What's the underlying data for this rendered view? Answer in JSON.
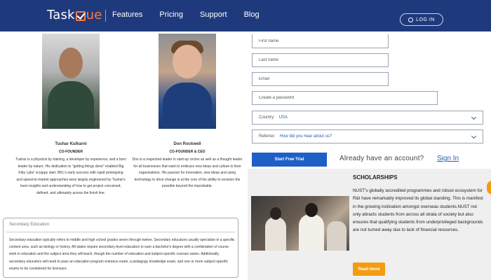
{
  "header": {
    "logo_text": "Task",
    "logo_accent": "ue",
    "nav": [
      "Features",
      "Pricing",
      "Support",
      "Blog"
    ],
    "login_label": "LOG IN"
  },
  "founders": [
    {
      "name": "Tushar Kulkarni",
      "role": "CO-FOUNDER",
      "bio": "Tushar is a physicist by training, a developer by experience, and a born leader by nature. His dedication to \"getting things done\" enabled Big Kitty Labs' scrappy start. BKL's early success with rapid prototyping and speed-to-market approaches were largely engineered by Tushar's keen insights and understanding of how to get project conceived, defined, and ultimately across the finish line."
    },
    {
      "name": "Don Rockwell",
      "role": "CO-FOUNDER & CEO",
      "bio": "Don is a respected leader in start-up circles as well as a thought leader for all businesses that want to embrace new ideas and culture in their organizations. His passion for innovation, new ideas and using technology to drive change is at the core of his ability to envision the possible beyond the improbable."
    }
  ],
  "secondary_education": {
    "title": "Secondary Education",
    "text": "Secondary education typically refers to middle and high school grades seven through twelve. Secondary educators usually specialize in a specific content area, such as biology or history. All states require secondary-level educators to earn a bachelor's degree with a combination of course work in education and the subject area they will teach, though the number of education and subject-specific courses varies. Additionally, secondary educators will need to pass an education program entrance exam, a pedagogy knowledge exam, and one or more subject-specific exams to be considered for licensure."
  },
  "form": {
    "first_name_placeholder": "First name",
    "last_name_placeholder": "Last name",
    "email_placeholder": "Email",
    "password_placeholder": "Create a password",
    "country_label": "Country:",
    "country_value": "USA",
    "referrer_label": "Referrer:",
    "referrer_value": "How did you hear about us?",
    "submit_label": "Start Free Trial",
    "account_text": "Already have an account?",
    "signin_label": "Sign In"
  },
  "scholarships": {
    "title": "SCHOLARSHIPS",
    "text": "NUST's globally accredited programmes and robust ecosystem for R&I have remarkably improved its global standing. This is manifest in the growing inclination amongst overseas students.NUST not only attracts students from across all strata of society but also ensures that qualifying students from underprivileged backgrounds are not turned away due to lack of financial resources.",
    "button_label": "Read more"
  },
  "colors": {
    "header_bg": "#1f3a7c",
    "accent_orange": "#f39c12",
    "primary_blue": "#1e5fc8"
  }
}
